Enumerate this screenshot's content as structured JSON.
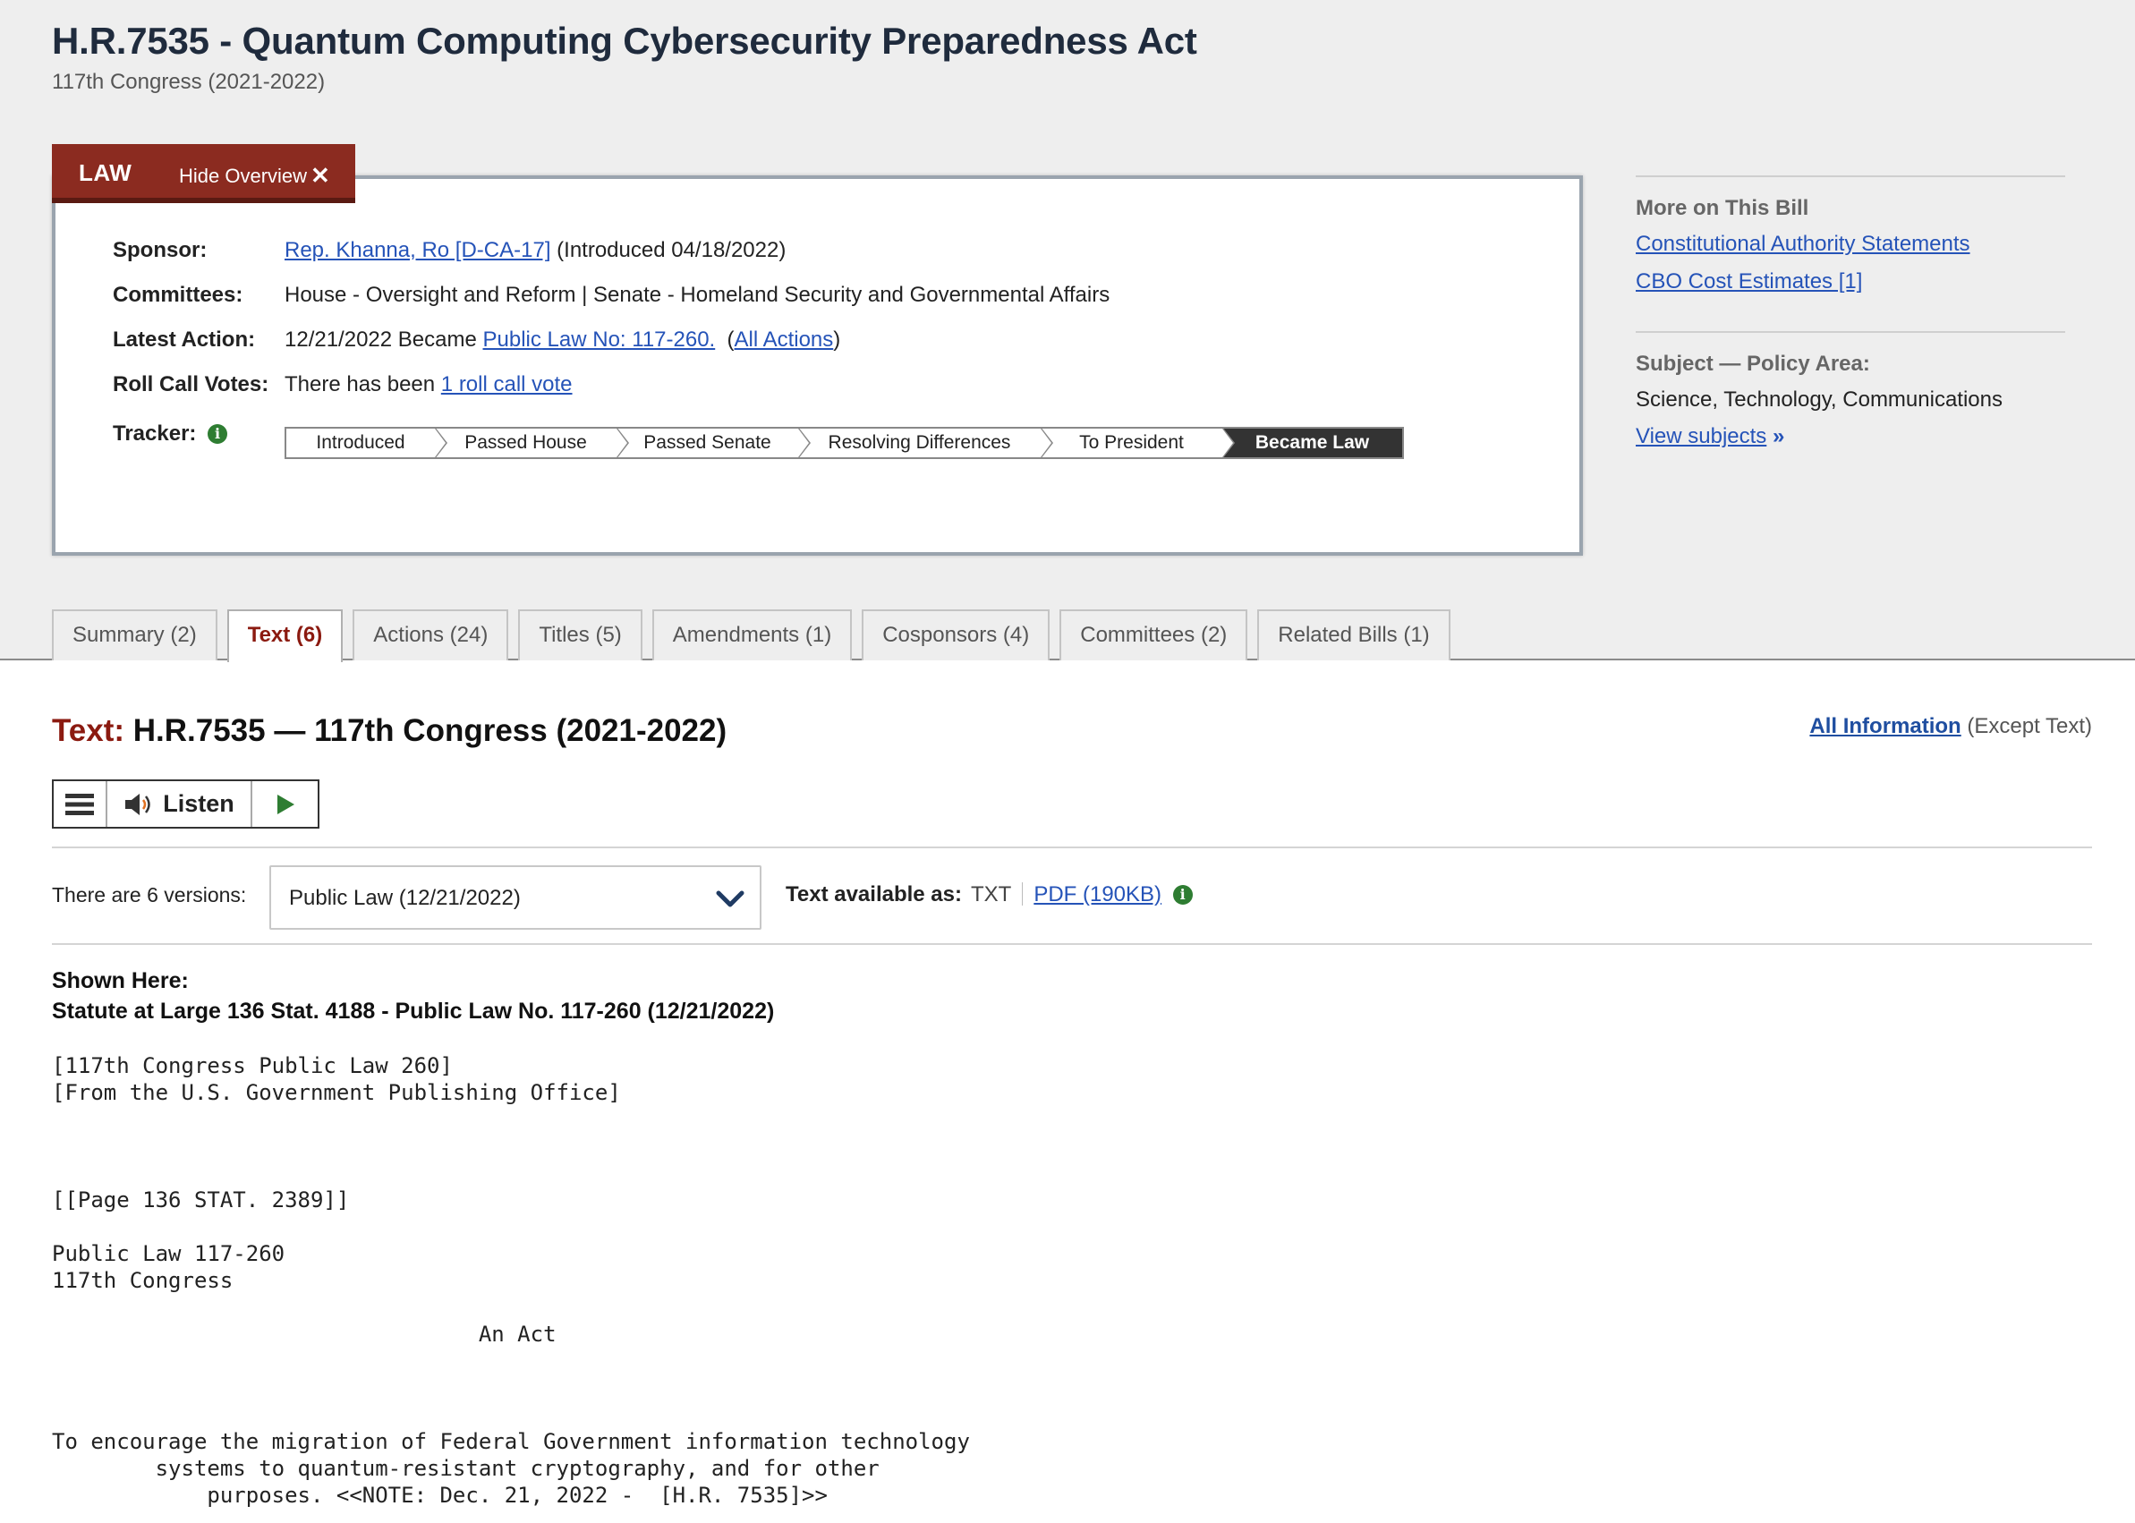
{
  "bill": {
    "title": "H.R.7535 - Quantum Computing Cybersecurity Preparedness Act",
    "congress": "117th Congress (2021-2022)"
  },
  "overview_tab": {
    "status": "LAW",
    "hide_label": "Hide Overview",
    "hide_icon": "close-icon"
  },
  "overview": {
    "sponsor_label": "Sponsor:",
    "sponsor_link": "Rep. Khanna, Ro [D-CA-17]",
    "sponsor_note": " (Introduced 04/18/2022)",
    "committees_label": "Committees:",
    "committees_value": "House - Oversight and Reform | Senate - Homeland Security and Governmental Affairs",
    "latest_label": "Latest Action:",
    "latest_prefix": "12/21/2022 Became ",
    "latest_link": "Public Law No: 117-260.",
    "all_actions_open": "  (",
    "all_actions_link": "All Actions",
    "all_actions_close": ")",
    "rollcall_label": "Roll Call Votes:",
    "rollcall_prefix": "There has been ",
    "rollcall_link": "1 roll call vote",
    "tracker_label": "Tracker:",
    "tracker_steps": [
      "Introduced",
      "Passed House",
      "Passed Senate",
      "Resolving Differences",
      "To President",
      "Became Law"
    ],
    "tracker_current": "Became Law"
  },
  "sidebar": {
    "more_heading": "More on This Bill",
    "more_links": [
      "Constitutional Authority Statements",
      "CBO Cost Estimates [1]"
    ],
    "subject_heading": "Subject — Policy Area:",
    "subject_value": "Science, Technology, Communications",
    "view_subjects": "View subjects"
  },
  "tabs": [
    {
      "label": "Summary (2)",
      "active": false
    },
    {
      "label": "Text (6)",
      "active": true
    },
    {
      "label": "Actions (24)",
      "active": false
    },
    {
      "label": "Titles (5)",
      "active": false
    },
    {
      "label": "Amendments (1)",
      "active": false
    },
    {
      "label": "Cosponsors (4)",
      "active": false
    },
    {
      "label": "Committees (2)",
      "active": false
    },
    {
      "label": "Related Bills (1)",
      "active": false
    }
  ],
  "text_panel": {
    "heading_prefix": "Text:",
    "heading_rest": " H.R.7535 — 117th Congress (2021-2022)",
    "all_info_link": "All Information",
    "all_info_note": " (Except Text)",
    "player": {
      "listen_label": "Listen",
      "icons": [
        "menu-icon",
        "speaker-icon",
        "play-icon"
      ]
    },
    "versions_label": "There are 6 versions:",
    "version_selected": "Public Law (12/21/2022)",
    "available_label": "Text available as:",
    "format_txt": "TXT",
    "format_pdf": "PDF (190KB)",
    "shown_here_label": "Shown Here:",
    "shown_here_value": "Statute at Large 136 Stat. 4188 - Public Law No. 117-260 (12/21/2022)",
    "legal_text": "[117th Congress Public Law 260]\n[From the U.S. Government Publishing Office]\n\n\n\n[[Page 136 STAT. 2389]]\n\nPublic Law 117-260\n117th Congress\n\n                                 An Act\n\n\n\nTo encourage the migration of Federal Government information technology\n        systems to quantum-resistant cryptography, and for other\n            purposes. <<NOTE: Dec. 21, 2022 -  [H.R. 7535]>>"
  },
  "colors": {
    "law_red": "#8b2b20",
    "link_blue": "#2553b8",
    "info_green": "#2e7d32",
    "title_navy": "#1f2b3d"
  }
}
